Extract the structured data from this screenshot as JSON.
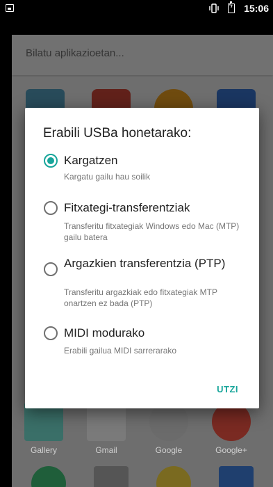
{
  "status_bar": {
    "time": "15:06",
    "icons": [
      "image-icon",
      "vibrate-icon",
      "battery-charging-icon"
    ]
  },
  "app_drawer": {
    "search_placeholder": "Bilatu aplikazioetan...",
    "bottom_apps": [
      {
        "label": "Gallery",
        "icon": "gallery-icon",
        "color": "#4db6ac"
      },
      {
        "label": "Gmail",
        "icon": "gmail-icon",
        "color": "#e53935"
      },
      {
        "label": "Google",
        "icon": "google-icon",
        "color": "#ffffff"
      },
      {
        "label": "Google+",
        "icon": "google-plus-icon",
        "color": "#e53935"
      }
    ]
  },
  "dialog": {
    "title": "Erabili USBa honetarako:",
    "options": [
      {
        "title": "Kargatzen",
        "subtitle": "Kargatu gailu hau soilik",
        "selected": true
      },
      {
        "title": "Fitxategi-transferentziak",
        "subtitle": "Transferitu fitxategiak Windows edo Mac (MTP) gailu batera",
        "selected": false
      },
      {
        "title": "Argazkien transferentzia (PTP)",
        "subtitle": "Transferitu argazkiak edo fitxategiak MTP onartzen ez bada (PTP)",
        "selected": false
      },
      {
        "title": "MIDI modurako",
        "subtitle": "Erabili gailua MIDI sarrerarako",
        "selected": false
      }
    ],
    "cancel_label": "UTZI"
  },
  "colors": {
    "accent": "#17a59a",
    "dialog_bg": "#ffffff",
    "overlay": "#000000"
  }
}
